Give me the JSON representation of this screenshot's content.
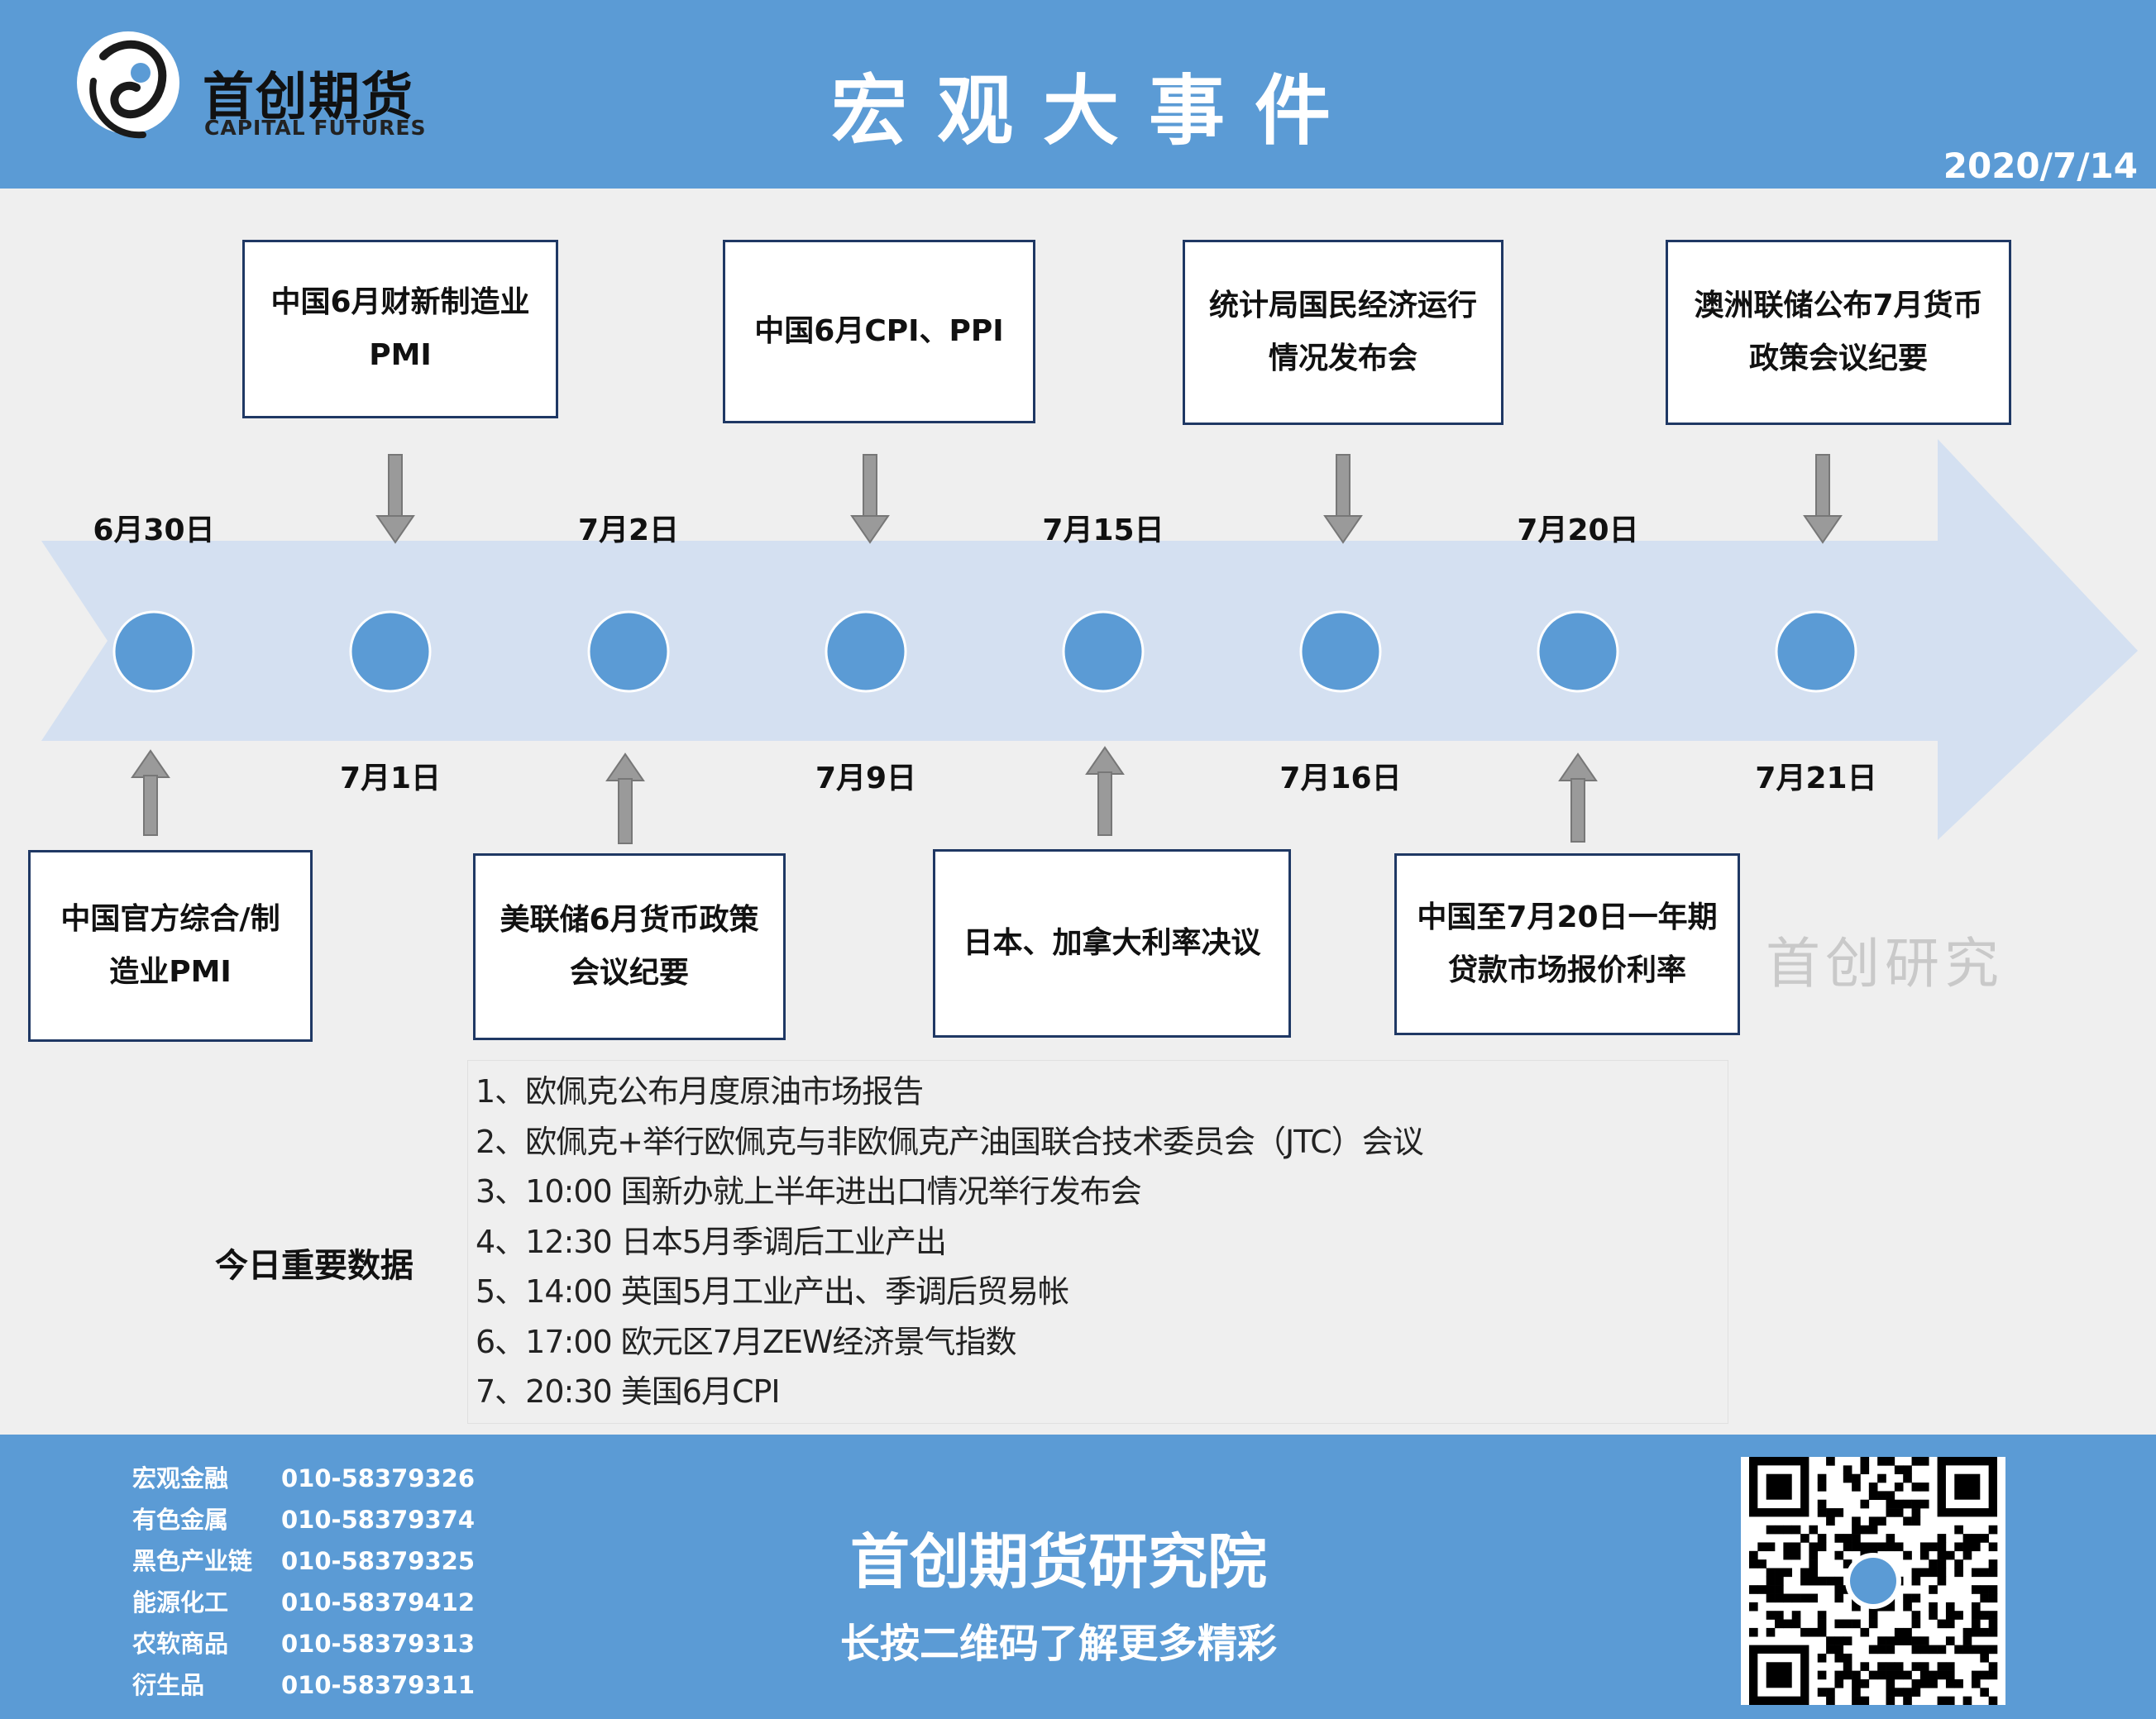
{
  "header": {
    "logo_cn": "首创期货",
    "logo_en": "CAPITAL FUTURES",
    "title": "宏观大事件",
    "date": "2020/7/14"
  },
  "timeline": {
    "dates_top": [
      "6月30日",
      "7月2日",
      "7月15日",
      "7月20日"
    ],
    "dates_bottom": [
      "7月1日",
      "7月9日",
      "7月16日",
      "7月21日"
    ],
    "events_top": [
      "中国6月财新制造业\nPMI",
      "中国6月CPI、PPI",
      "统计局国民经济运行\n情况发布会",
      "澳洲联储公布7月货币\n政策会议纪要"
    ],
    "events_bottom": [
      "中国官方综合/制\n造业PMI",
      "美联储6月货币政策\n会议纪要",
      "日本、加拿大利率决议",
      "中国至7月20日一年期\n贷款市场报价利率"
    ]
  },
  "watermark": "首创研究",
  "important_data": {
    "title": "今日重要数据",
    "items": [
      "1、欧佩克公布月度原油市场报告",
      "2、欧佩克+举行欧佩克与非欧佩克产油国联合技术委员会（JTC）会议",
      "3、10:00 国新办就上半年进出口情况举行发布会",
      "4、12:30 日本5月季调后工业产出",
      "5、14:00 英国5月工业产出、季调后贸易帐",
      "6、17:00 欧元区7月ZEW经济景气指数",
      "7、20:30 美国6月CPI"
    ]
  },
  "footer": {
    "contacts": [
      {
        "dept": "宏观金融",
        "phone": "010-58379326"
      },
      {
        "dept": "有色金属",
        "phone": "010-58379374"
      },
      {
        "dept": "黑色产业链",
        "phone": "010-58379325"
      },
      {
        "dept": "能源化工",
        "phone": "010-58379412"
      },
      {
        "dept": "农软商品",
        "phone": "010-58379313"
      },
      {
        "dept": "衍生品",
        "phone": "010-58379311"
      }
    ],
    "institute": "首创期货研究院",
    "slogan": "长按二维码了解更多精彩"
  },
  "colors": {
    "header_bg": "#5b9bd5",
    "arrow_band": "#d4e0f1",
    "node_fill": "#5b9bd5",
    "box_border": "#1f3864",
    "connector": "#8c8c8c"
  }
}
